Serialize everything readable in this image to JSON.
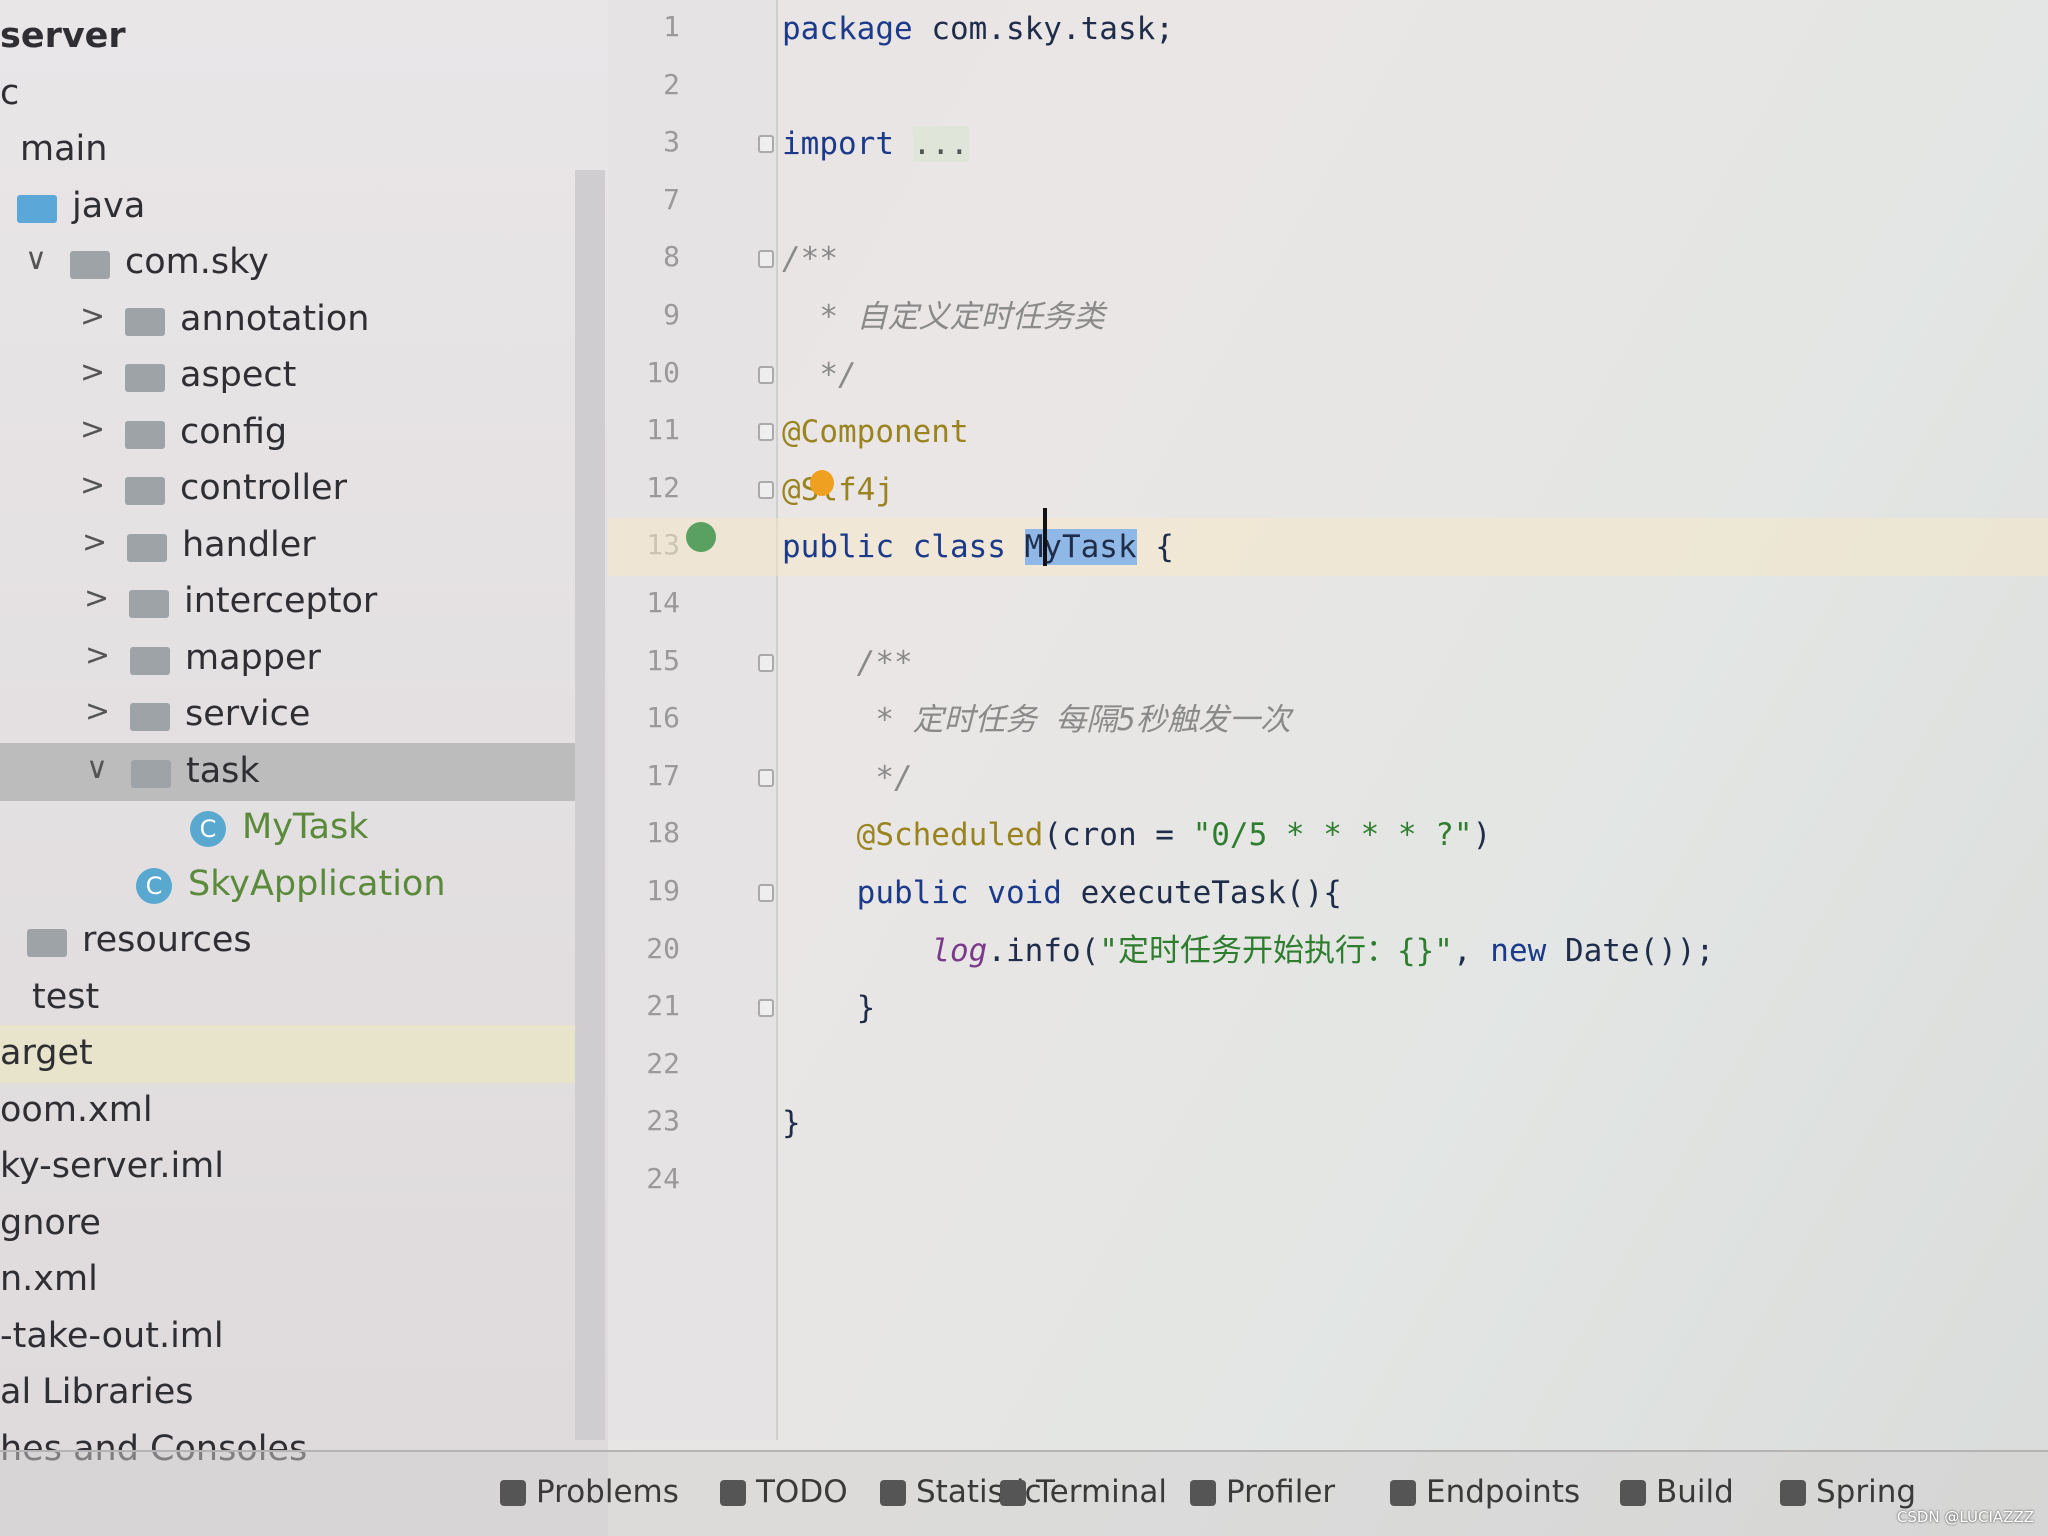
{
  "project_tree": [
    {
      "label": "server",
      "indent": -4,
      "chevron": "",
      "icon": "none",
      "style": "bold"
    },
    {
      "label": "c",
      "indent": 0,
      "chevron": "",
      "icon": "none"
    },
    {
      "label": "main",
      "indent": 20,
      "chevron": "",
      "icon": "none"
    },
    {
      "label": "java",
      "indent": 72,
      "chevron": "",
      "icon": "folder-blue"
    },
    {
      "label": "com.sky",
      "indent": 125,
      "chevron": "∨",
      "icon": "folder"
    },
    {
      "label": "annotation",
      "indent": 180,
      "chevron": ">",
      "icon": "folder"
    },
    {
      "label": "aspect",
      "indent": 180,
      "chevron": ">",
      "icon": "folder"
    },
    {
      "label": "config",
      "indent": 180,
      "chevron": ">",
      "icon": "folder"
    },
    {
      "label": "controller",
      "indent": 180,
      "chevron": ">",
      "icon": "folder"
    },
    {
      "label": "handler",
      "indent": 182,
      "chevron": ">",
      "icon": "folder"
    },
    {
      "label": "interceptor",
      "indent": 184,
      "chevron": ">",
      "icon": "folder"
    },
    {
      "label": "mapper",
      "indent": 185,
      "chevron": ">",
      "icon": "folder"
    },
    {
      "label": "service",
      "indent": 185,
      "chevron": ">",
      "icon": "folder"
    },
    {
      "label": "task",
      "indent": 186,
      "chevron": "∨",
      "icon": "folder",
      "selected": true
    },
    {
      "label": "MyTask",
      "indent": 242,
      "chevron": "",
      "icon": "class",
      "style": "cls"
    },
    {
      "label": "SkyApplication",
      "indent": 188,
      "chevron": "",
      "icon": "class",
      "style": "cls"
    },
    {
      "label": "resources",
      "indent": 82,
      "chevron": "",
      "icon": "folder"
    },
    {
      "label": "test",
      "indent": 32,
      "chevron": "",
      "icon": "none"
    },
    {
      "label": "arget",
      "indent": 0,
      "chevron": "",
      "icon": "none",
      "highlight": true
    },
    {
      "label": "oom.xml",
      "indent": 0,
      "chevron": "",
      "icon": "none"
    },
    {
      "label": "ky-server.iml",
      "indent": 0,
      "chevron": "",
      "icon": "none"
    },
    {
      "label": "gnore",
      "indent": 0,
      "chevron": "",
      "icon": "none"
    },
    {
      "label": "n.xml",
      "indent": 0,
      "chevron": "",
      "icon": "none"
    },
    {
      "label": "-take-out.iml",
      "indent": 0,
      "chevron": "",
      "icon": "none"
    },
    {
      "label": "al Libraries",
      "indent": 0,
      "chevron": "",
      "icon": "none"
    },
    {
      "label": "hes and Consoles",
      "indent": 0,
      "chevron": "",
      "icon": "none"
    }
  ],
  "editor": {
    "lines": [
      {
        "n": "1",
        "tokens": [
          [
            "package ",
            "kw"
          ],
          [
            "com.sky.task;",
            ""
          ]
        ]
      },
      {
        "n": "2",
        "tokens": []
      },
      {
        "n": "3",
        "fold": true,
        "tokens": [
          [
            "import ",
            "kw"
          ],
          [
            "...",
            "fold-text"
          ]
        ]
      },
      {
        "n": "7",
        "tokens": []
      },
      {
        "n": "8",
        "fold": true,
        "tokens": [
          [
            "/**",
            "cm"
          ]
        ]
      },
      {
        "n": "9",
        "tokens": [
          [
            "  * 自定义定时任务类",
            "cm"
          ]
        ]
      },
      {
        "n": "10",
        "fold": true,
        "tokens": [
          [
            "  */",
            "cm"
          ]
        ]
      },
      {
        "n": "11",
        "fold": true,
        "tokens": [
          [
            "@Component",
            "ann"
          ]
        ]
      },
      {
        "n": "12",
        "fold": true,
        "tokens": [
          [
            "@Slf4j",
            "ann"
          ]
        ]
      },
      {
        "n": "13",
        "current": true,
        "tokens": [
          [
            "public class ",
            "kw"
          ],
          [
            "MyTask",
            "sel"
          ],
          [
            " {",
            ""
          ]
        ]
      },
      {
        "n": "14",
        "tokens": []
      },
      {
        "n": "15",
        "fold": true,
        "tokens": [
          [
            "    /**",
            "cm"
          ]
        ]
      },
      {
        "n": "16",
        "tokens": [
          [
            "     * 定时任务 每隔5秒触发一次",
            "cm"
          ]
        ]
      },
      {
        "n": "17",
        "fold": true,
        "tokens": [
          [
            "     */",
            "cm"
          ]
        ]
      },
      {
        "n": "18",
        "tokens": [
          [
            "    @Scheduled",
            "ann"
          ],
          [
            "(cron = ",
            ""
          ],
          [
            "\"0/5 * * * * ?\"",
            "str"
          ],
          [
            ")",
            ""
          ]
        ]
      },
      {
        "n": "19",
        "fold": true,
        "tokens": [
          [
            "    public void ",
            "kw"
          ],
          [
            "executeTask(){",
            ""
          ]
        ]
      },
      {
        "n": "20",
        "tokens": [
          [
            "        ",
            ""
          ],
          [
            "log",
            "log"
          ],
          [
            ".info(",
            ""
          ],
          [
            "\"定时任务开始执行：{}\"",
            "str"
          ],
          [
            ", ",
            ""
          ],
          [
            "new ",
            "kw"
          ],
          [
            "Date());",
            ""
          ]
        ]
      },
      {
        "n": "21",
        "fold": true,
        "tokens": [
          [
            "    }",
            ""
          ]
        ]
      },
      {
        "n": "22",
        "tokens": []
      },
      {
        "n": "23",
        "tokens": [
          [
            "}",
            ""
          ]
        ]
      },
      {
        "n": "24",
        "tokens": []
      }
    ]
  },
  "bottom_toolbar": [
    {
      "label": "Problems",
      "icon": "problems-icon"
    },
    {
      "label": "TODO",
      "icon": "todo-icon"
    },
    {
      "label": "Statistic",
      "icon": "statistic-icon"
    },
    {
      "label": "Terminal",
      "icon": "terminal-icon"
    },
    {
      "label": "Profiler",
      "icon": "profiler-icon"
    },
    {
      "label": "Endpoints",
      "icon": "endpoints-icon"
    },
    {
      "label": "Build",
      "icon": "hammer-icon"
    },
    {
      "label": "Spring",
      "icon": "spring-leaf-icon"
    }
  ],
  "watermark": "CSDN @LUCIAZZZ"
}
